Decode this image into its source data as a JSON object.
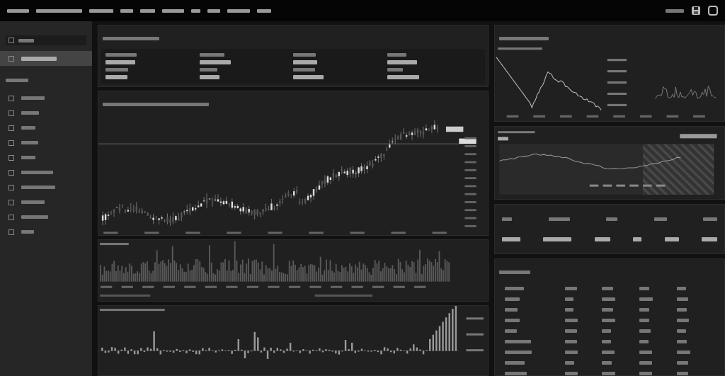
{
  "sidebar": {
    "items": [
      {
        "kind": "search"
      },
      {
        "kind": "item",
        "selected": true
      },
      {
        "kind": "heading"
      },
      {
        "kind": "item",
        "selected": false
      },
      {
        "kind": "item",
        "selected": false
      },
      {
        "kind": "item",
        "selected": false
      },
      {
        "kind": "item",
        "selected": false
      },
      {
        "kind": "item",
        "selected": false
      },
      {
        "kind": "item",
        "selected": false
      },
      {
        "kind": "item",
        "selected": false
      },
      {
        "kind": "item",
        "selected": false
      },
      {
        "kind": "item",
        "selected": false
      },
      {
        "kind": "item",
        "selected": false
      }
    ]
  },
  "main": {
    "panels": [
      {
        "kind": "stats"
      },
      {
        "kind": "candles"
      },
      {
        "kind": "volume"
      },
      {
        "kind": "bars"
      }
    ]
  },
  "side": {
    "panels": [
      {
        "kind": "lines"
      },
      {
        "kind": "area"
      },
      {
        "kind": "summary"
      },
      {
        "kind": "table",
        "rows": [
          {
            "selected": false
          },
          {
            "selected": false
          },
          {
            "selected": false
          },
          {
            "selected": false
          },
          {
            "selected": false
          },
          {
            "selected": false
          },
          {
            "selected": false
          },
          {
            "selected": false
          },
          {
            "selected": false
          }
        ]
      }
    ]
  }
}
